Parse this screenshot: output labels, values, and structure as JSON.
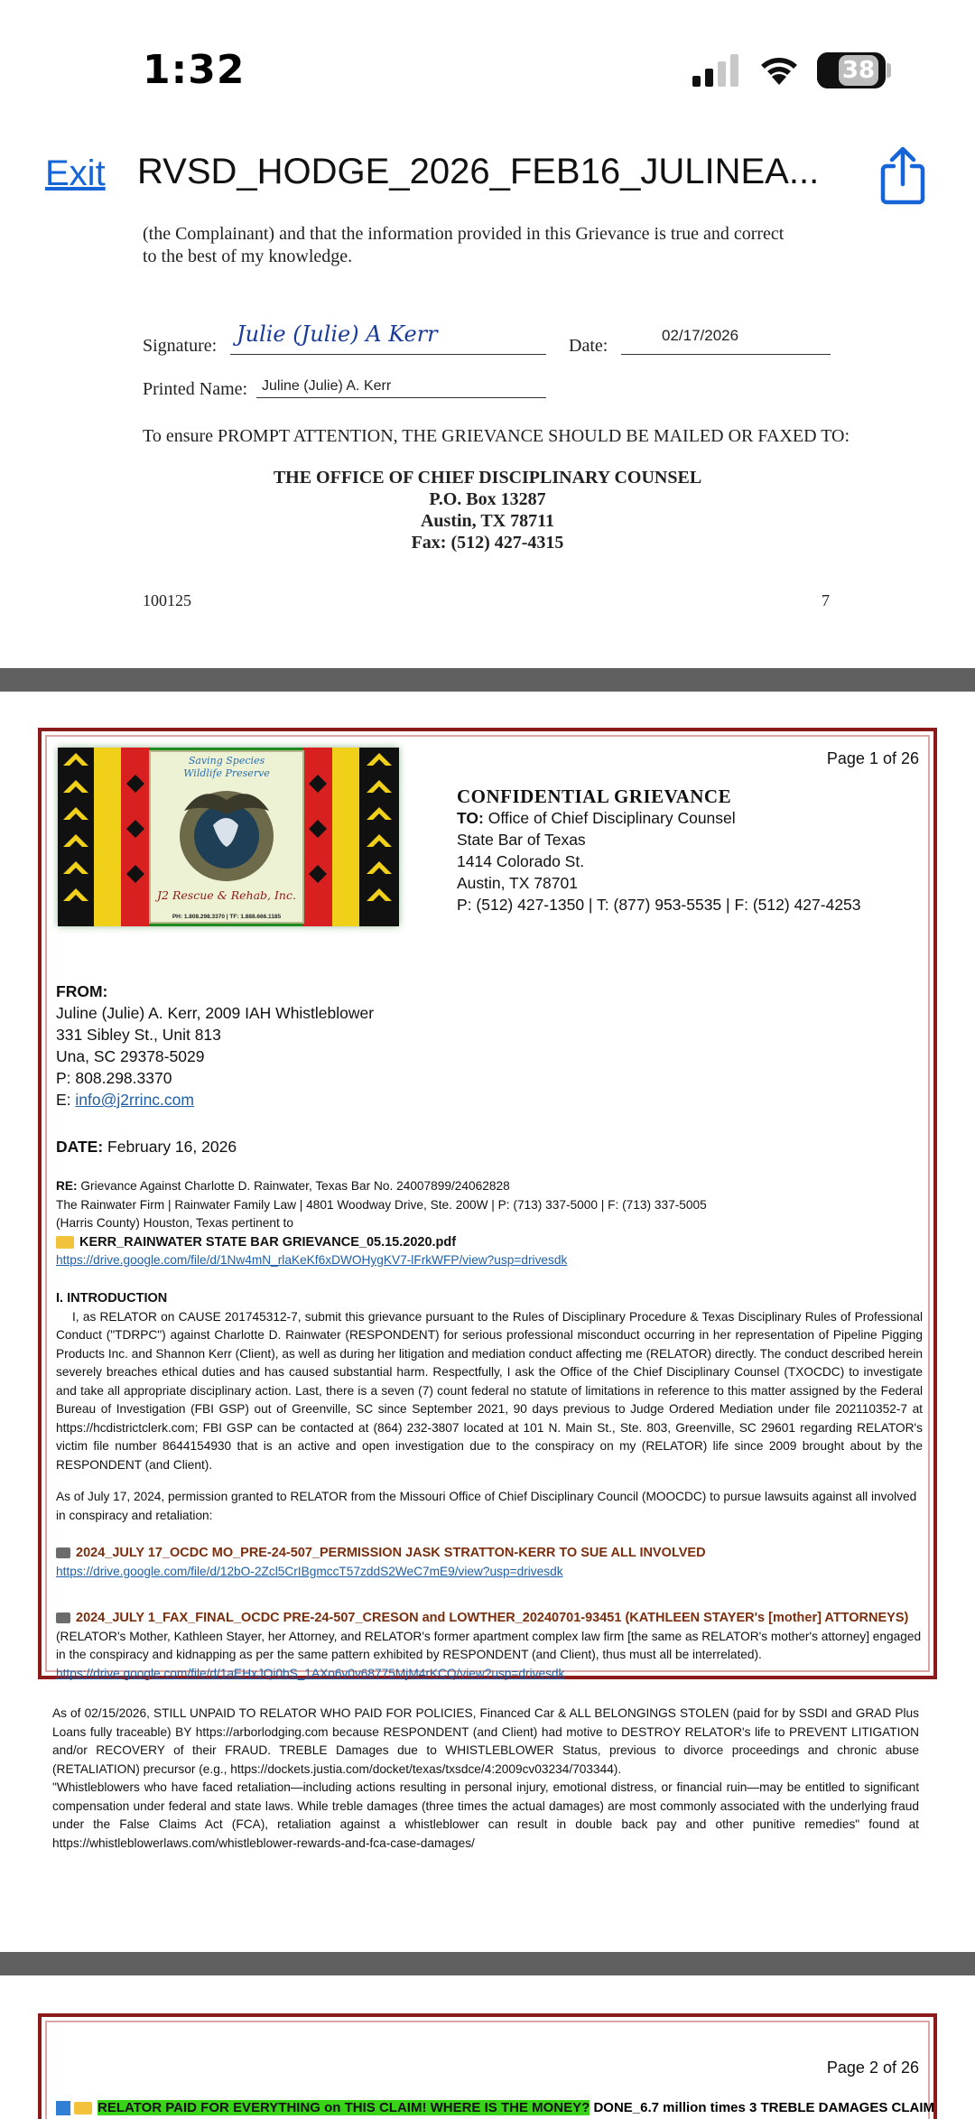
{
  "status_bar": {
    "time": "1:32",
    "battery_level": "38"
  },
  "nav": {
    "exit_label": "Exit",
    "title": "RVSD_HODGE_2026_FEB16_JULINEA..."
  },
  "page_prev": {
    "intro_line1": "(the Complainant) and that the information provided in this Grievance is true and correct",
    "intro_line2": "to the best of my knowledge.",
    "signature_label": "Signature:",
    "signature_value": "Juline (Julie) A Kerr",
    "date_label": "Date:",
    "date_value": "02/17/2026",
    "printed_label": "Printed Name:",
    "printed_value": "Juline (Julie) A. Kerr",
    "ensure_text": "To ensure PROMPT ATTENTION, THE GRIEVANCE SHOULD BE MAILED OR FAXED TO:",
    "office": "THE OFFICE OF CHIEF DISCIPLINARY COUNSEL",
    "po": "P.O. Box 13287",
    "city": "Austin, TX 78711",
    "fax": "Fax: (512) 427-4315",
    "footer_code": "100125",
    "footer_page": "7"
  },
  "page1": {
    "page_num": "Page 1 of 26",
    "logo_top": "Saving Species",
    "logo_sub": "Wildlife Preserve",
    "logo_name": "J2 Rescue & Rehab, Inc.",
    "logo_phone": "PH: 1.808.298.3370 | TF: 1.888.666.1185",
    "conf_title": "CONFIDENTIAL GRIEVANCE",
    "to_label": "TO:",
    "to_value": "Office of Chief Disciplinary Counsel",
    "to_line2": "State Bar of Texas",
    "to_line3": "1414 Colorado St.",
    "to_line4": "Austin, TX 78701",
    "to_line5": "P: (512) 427-1350 | T: (877) 953-5535 | F: (512) 427-4253",
    "from_label": "FROM:",
    "from_line1": "Juline (Julie) A. Kerr, 2009 IAH Whistleblower",
    "from_line2": "331 Sibley St., Unit 813",
    "from_line3": "Una, SC 29378-5029",
    "from_line4": "P: 808.298.3370",
    "from_email_label": "E:",
    "from_email": "info@j2rrinc.com",
    "date_label": "DATE:",
    "date_value": "February 16, 2026",
    "re_label": "RE:",
    "re_line1": "Grievance Against Charlotte D. Rainwater, Texas Bar No. 24007899/24062828",
    "re_line2": "The Rainwater Firm | Rainwater Family Law | 4801 Woodway Drive, Ste. 200W | P: (713) 337-5000 | F: (713) 337-5005",
    "re_line3": "(Harris County) Houston, Texas pertinent to",
    "file1": "KERR_RAINWATER STATE BAR GRIEVANCE_05.15.2020.pdf",
    "link1": "https://drive.google.com/file/d/1Nw4mN_rlaKeKf6xDWOHygKV7-lFrkWFP/view?usp=drivesdk",
    "intro_heading": "I. INTRODUCTION",
    "intro_text": "I, as RELATOR on CAUSE 201745312-7, submit this grievance pursuant to the Rules of Disciplinary Procedure & Texas Disciplinary Rules of Professional Conduct (\"TDRPC\") against Charlotte D. Rainwater (RESPONDENT) for serious professional misconduct occurring in her representation of Pipeline Pigging Products Inc. and Shannon Kerr (Client), as well as during her litigation and mediation conduct affecting me (RELATOR) directly. The conduct described herein severely breaches ethical duties and has caused substantial harm. Respectfully, I ask the Office of the Chief Disciplinary Counsel (TXOCDC) to investigate and take all appropriate disciplinary action. Last, there is a seven (7) count federal no statute of limitations in reference to this matter assigned by the Federal Bureau of Investigation (FBI GSP) out of Greenville, SC since September 2021, 90 days previous to Judge Ordered Mediation under file 202110352-7 at https://hcdistrictclerk.com; FBI GSP can be contacted at (864) 232-3807 located at 101 N. Main St., Ste. 803, Greenville, SC 29601 regarding RELATOR's victim file number 8644154930 that is an active and open investigation due to the conspiracy on my (RELATOR) life since 2009 brought about by the RESPONDENT (and Client).",
    "mo_text": "As of July 17, 2024, permission granted to RELATOR from the Missouri Office of Chief Disciplinary Council (MOOCDC) to pursue lawsuits against all involved in conspiracy and retaliation:",
    "sec1": "2024_JULY 17_OCDC MO_PRE-24-507_PERMISSION JASK STRATTON-KERR TO SUE ALL INVOLVED",
    "link2": "https://drive.google.com/file/d/12bO-2Zcl5CrIBgmccT57zddS2WeC7mE9/view?usp=drivesdk",
    "sec2": "2024_JULY 1_FAX_FINAL_OCDC PRE-24-507_CRESON and LOWTHER_20240701-93451 (KATHLEEN STAYER's [mother] ATTORNEYS)",
    "sec2_text": "(RELATOR's Mother, Kathleen Stayer, her Attorney, and RELATOR's former apartment complex law firm [the same as RELATOR's mother's attorney] engaged in the conspiracy and kidnapping as per the same pattern exhibited by RESPONDENT (and Client), thus must all be interrelated).",
    "link3": "https://drive.google.com/file/d/1aEHxJQi0bS_1AXo6v0v68775MjM4rKCQ/view?usp=drivesdk",
    "unpaid_text": "As of 02/15/2026, STILL UNPAID TO RELATOR WHO PAID FOR POLICIES, Financed Car & ALL BELONGINGS STOLEN (paid for by SSDI and GRAD Plus Loans fully traceable) BY https://arborlodging.com because RESPONDENT (and Client) had motive to DESTROY RELATOR's life to PREVENT LITIGATION and/or RECOVERY of their FRAUD. TREBLE Damages due to WHISTLEBLOWER Status, previous to divorce proceedings and chronic abuse (RETALIATION) precursor (e.g., https://dockets.justia.com/docket/texas/txsdce/4:2009cv03234/703344).",
    "quote_text": "\"Whistleblowers who have faced retaliation—including actions resulting in personal injury, emotional distress, or financial ruin—may be entitled to significant compensation under federal and state laws. While treble damages (three times the actual damages) are most commonly associated with the underlying fraud under the False Claims Act (FCA), retaliation against a whistleblower can result in double back pay and other punitive remedies\" found at https://whistleblowerlaws.com/whistleblower-rewards-and-fca-case-damages/"
  },
  "page2": {
    "page_num": "Page 2 of 26",
    "banner_highlight": "RELATOR PAID FOR EVERYTHING on THIS CLAIM! WHERE IS THE MONEY?",
    "banner_rest": "DONE_6.7 million times 3 TREBLE DAMAGES CLAIM"
  },
  "colors": {
    "accent": "#1565d8",
    "page_border": "#8b1a1a",
    "gap": "#5f605f",
    "link": "#1e5fa5",
    "highlight": "#39d41a"
  }
}
